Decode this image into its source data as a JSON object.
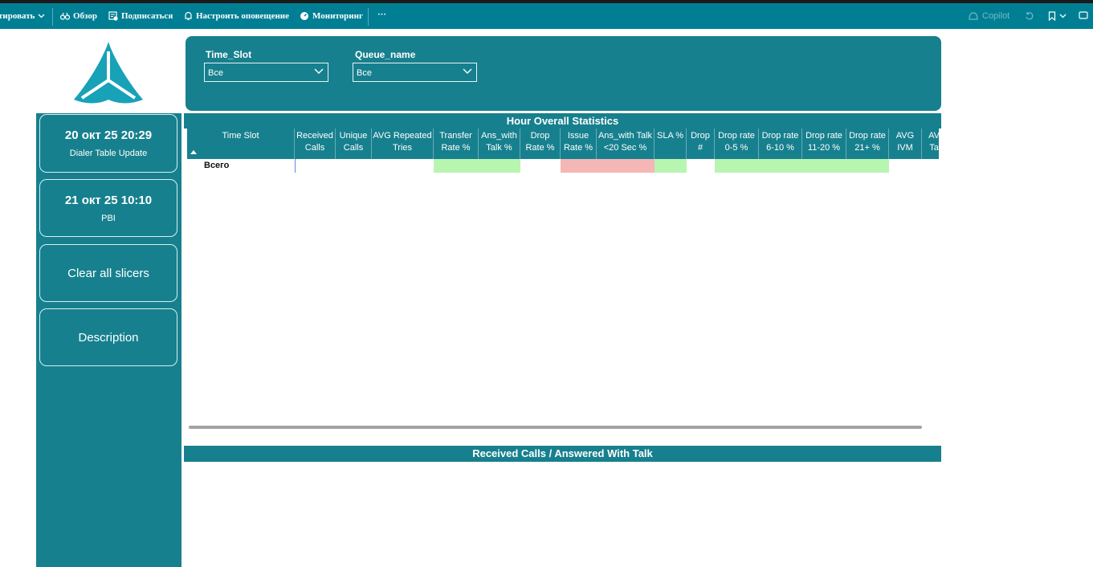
{
  "toolbar": {
    "export_label": "тировать",
    "overview_label": "Обзор",
    "subscribe_label": "Подписаться",
    "alert_label": "Настроить оповещение",
    "monitoring_label": "Мониторинг",
    "more_label": "···",
    "copilot_label": "Copilot"
  },
  "sidebar": {
    "card1": {
      "title": "20 окт 25 20:29",
      "subtitle": "Dialer Table Update"
    },
    "card2": {
      "title": "21 окт 25 10:10",
      "subtitle": "PBI"
    },
    "clear_label": "Clear all slicers",
    "description_label": "Description"
  },
  "slicers": {
    "time_slot": {
      "label": "Time_Slot",
      "value": "Все"
    },
    "queue_name": {
      "label": "Queue_name",
      "value": "Все"
    }
  },
  "table": {
    "title": "Hour Overall Statistics",
    "columns": [
      {
        "l1": "Time Slot",
        "l2": ""
      },
      {
        "l1": "Received",
        "l2": "Calls"
      },
      {
        "l1": "Unique",
        "l2": "Calls"
      },
      {
        "l1": "AVG Repeated",
        "l2": "Tries"
      },
      {
        "l1": "Transfer",
        "l2": "Rate %"
      },
      {
        "l1": "Ans_with",
        "l2": "Talk %"
      },
      {
        "l1": "Drop",
        "l2": "Rate %"
      },
      {
        "l1": "Issue",
        "l2": "Rate %"
      },
      {
        "l1": "Ans_with Talk",
        "l2": "<20 Sec %"
      },
      {
        "l1": "SLA %",
        "l2": ""
      },
      {
        "l1": "Drop",
        "l2": "#"
      },
      {
        "l1": "Drop rate",
        "l2": "0-5 %"
      },
      {
        "l1": "Drop rate",
        "l2": "6-10 %"
      },
      {
        "l1": "Drop rate",
        "l2": "11-20 %"
      },
      {
        "l1": "Drop rate",
        "l2": "21+ %"
      },
      {
        "l1": "AVG",
        "l2": "IVM"
      },
      {
        "l1": "AV",
        "l2": "Ta"
      }
    ],
    "total_row_label": "Всего"
  },
  "chart": {
    "title": "Received Calls / Answered With Talk"
  },
  "colors": {
    "teal": "#17808e",
    "topbar": "#007f94",
    "good": "#b8f5b0",
    "bad": "#f5b6b6"
  }
}
